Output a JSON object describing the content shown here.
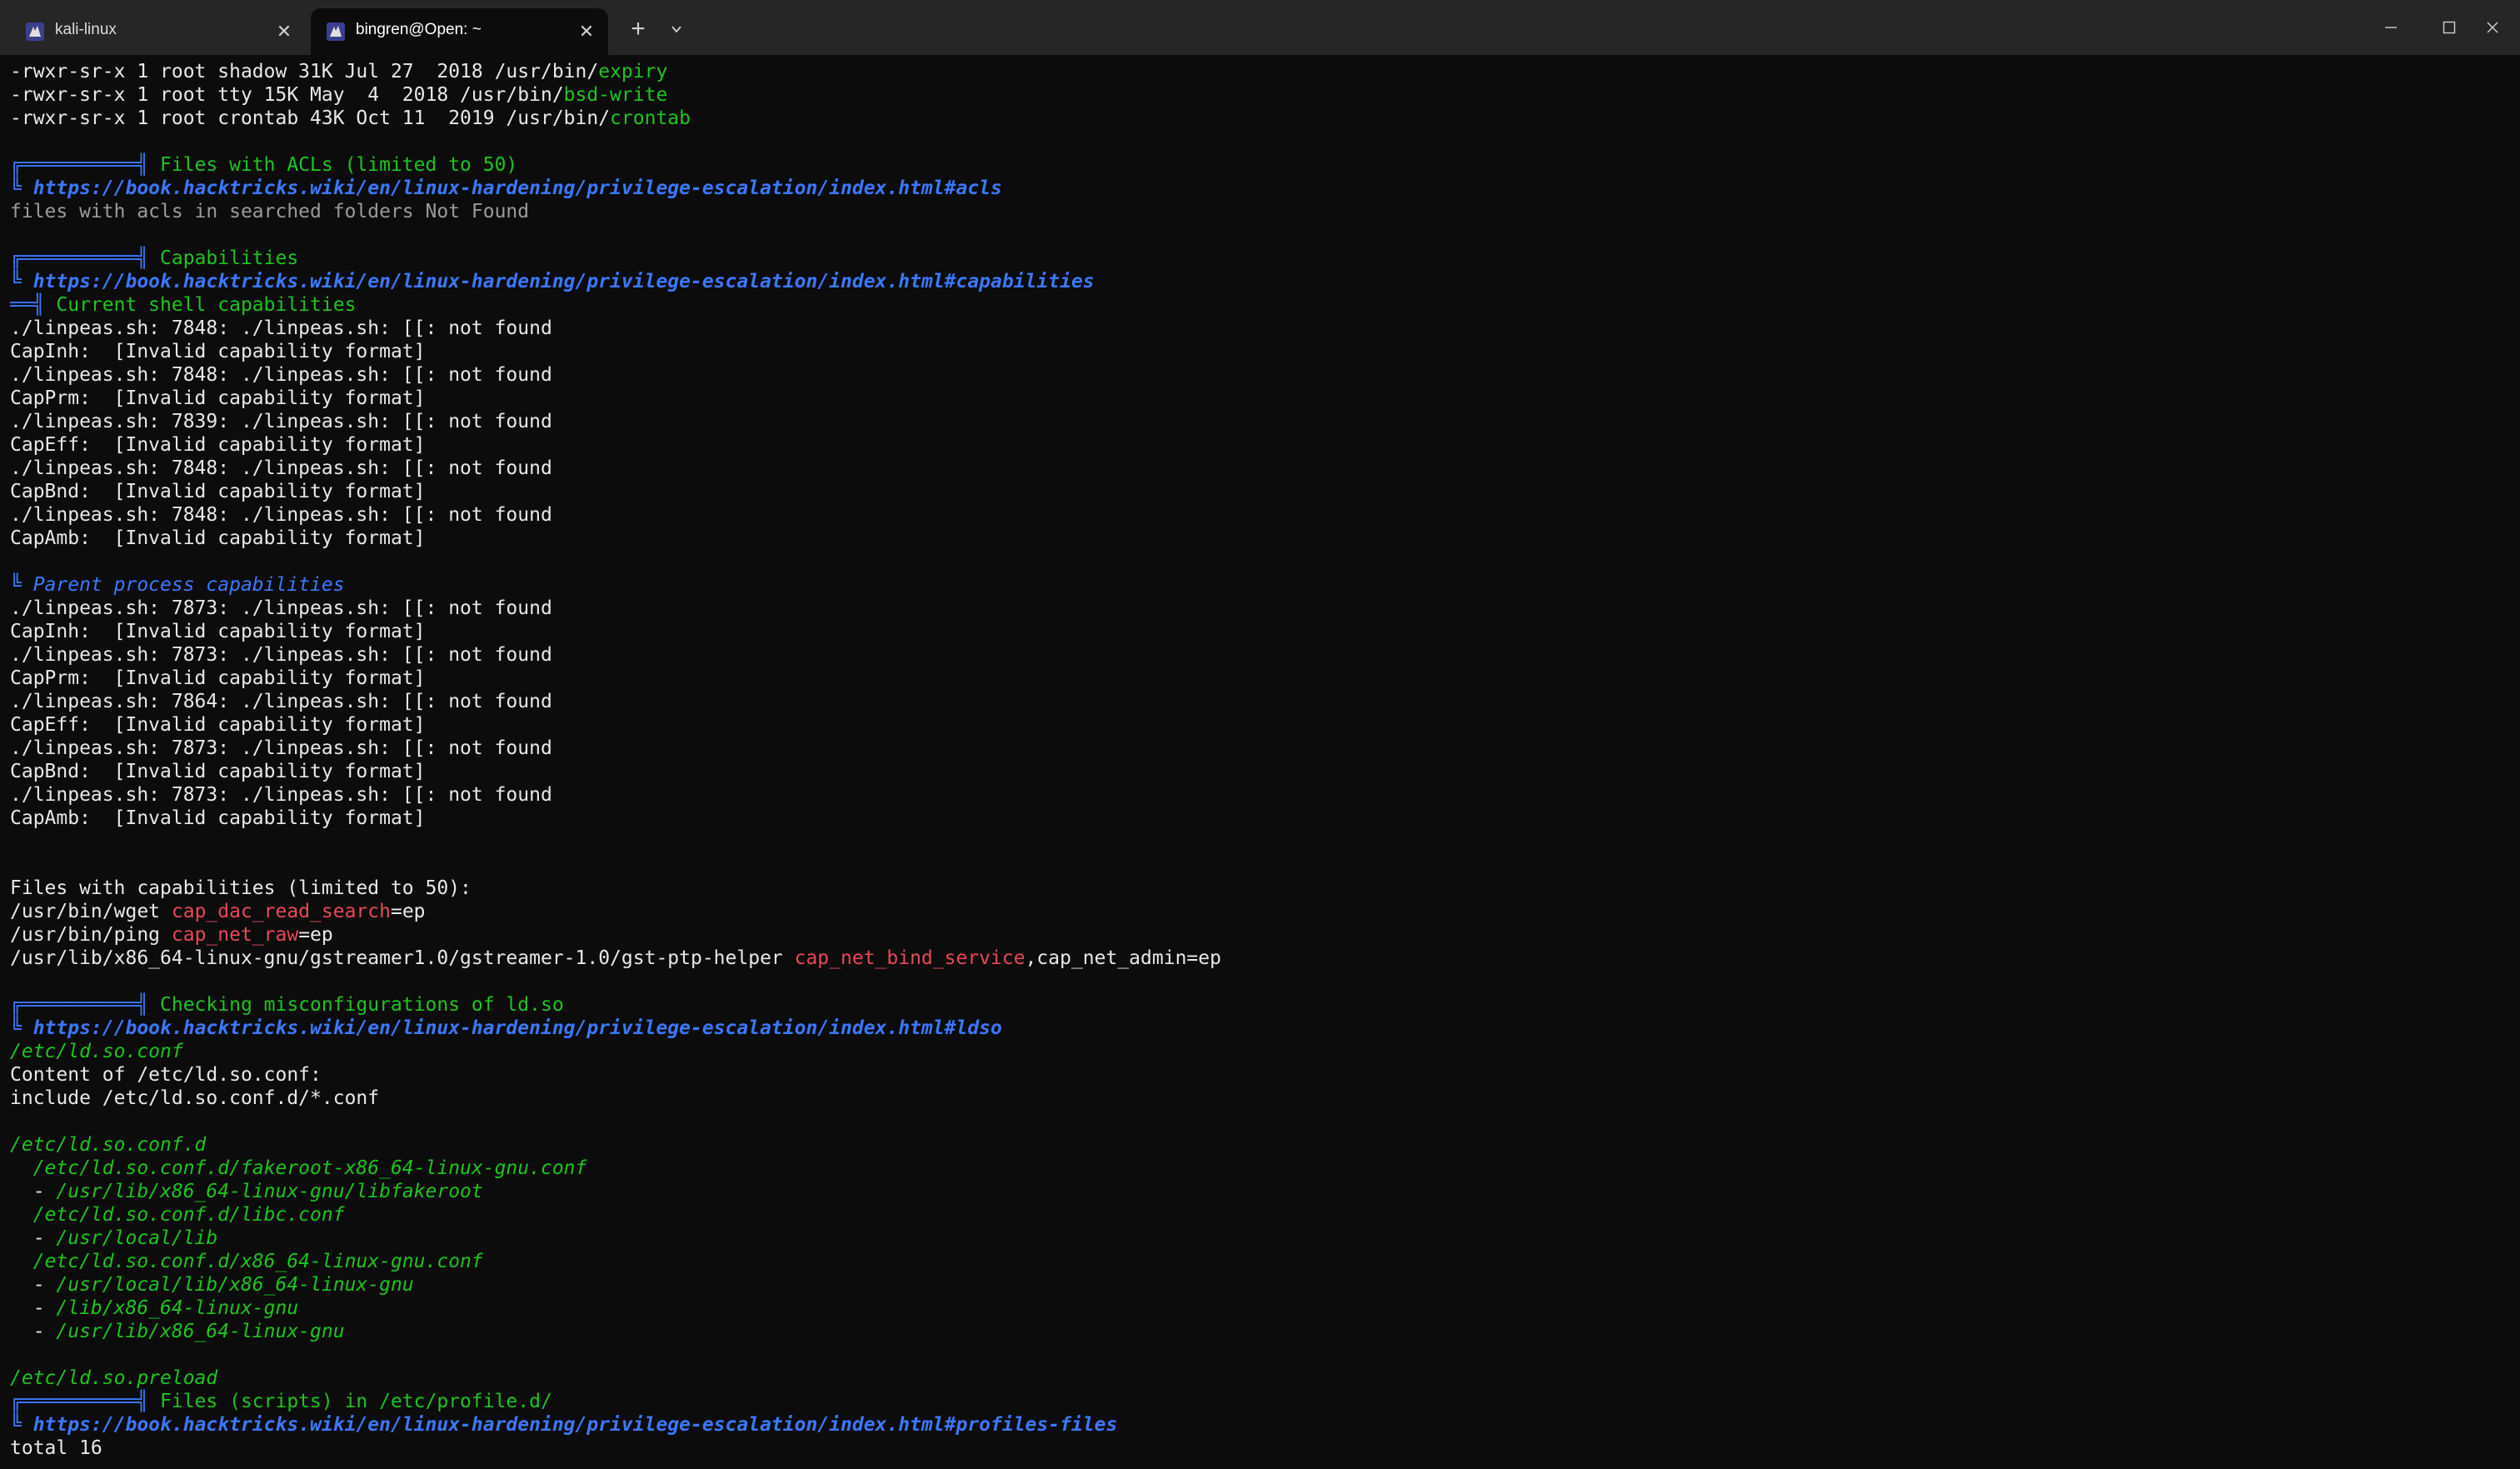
{
  "window": {
    "tabs": [
      {
        "title": "kali-linux",
        "active": false,
        "icon": "terminal-profile-icon"
      },
      {
        "title": "bingren@Open: ~",
        "active": true,
        "icon": "terminal-profile-icon"
      }
    ],
    "new_tab_label": "+",
    "close_glyph": "✕"
  },
  "colors": {
    "background": "#0c0c0c",
    "text": "#e8e8e8",
    "green": "#1ec41e",
    "blue": "#3b78ff",
    "red": "#e74856",
    "gray": "#9a9a9a"
  },
  "terminal": {
    "lines": [
      [
        {
          "t": "-rwxr-sr-x 1 root shadow 31K Jul 27  2018 /usr/bin/",
          "s": "white"
        },
        {
          "t": "expiry",
          "s": "green"
        }
      ],
      [
        {
          "t": "-rwxr-sr-x 1 root tty 15K May  4  2018 /usr/bin/",
          "s": "white"
        },
        {
          "t": "bsd-write",
          "s": "green"
        }
      ],
      [
        {
          "t": "-rwxr-sr-x 1 root crontab 43K Oct 11  2019 /usr/bin/",
          "s": "white"
        },
        {
          "t": "crontab",
          "s": "green"
        }
      ],
      [],
      [
        {
          "t": "╔══════════╣ ",
          "s": "blue"
        },
        {
          "t": "Files with ACLs (limited to 50)",
          "s": "green"
        }
      ],
      [
        {
          "t": "╚ ",
          "s": "blue"
        },
        {
          "t": "https://book.hacktricks.wiki/en/linux-hardening/privilege-escalation/index.html#acls",
          "s": "blue-bi"
        }
      ],
      [
        {
          "t": "files with acls in searched folders Not Found",
          "s": "gray"
        }
      ],
      [],
      [
        {
          "t": "╔══════════╣ ",
          "s": "blue"
        },
        {
          "t": "Capabilities",
          "s": "green"
        }
      ],
      [
        {
          "t": "╚ ",
          "s": "blue"
        },
        {
          "t": "https://book.hacktricks.wiki/en/linux-hardening/privilege-escalation/index.html#capabilities",
          "s": "blue-bi"
        }
      ],
      [
        {
          "t": "══╣ ",
          "s": "blue"
        },
        {
          "t": "Current shell capabilities",
          "s": "green"
        }
      ],
      [
        {
          "t": "./linpeas.sh: 7848: ./linpeas.sh: [[: not found",
          "s": "white"
        }
      ],
      [
        {
          "t": "CapInh:  [Invalid capability format]",
          "s": "white"
        }
      ],
      [
        {
          "t": "./linpeas.sh: 7848: ./linpeas.sh: [[: not found",
          "s": "white"
        }
      ],
      [
        {
          "t": "CapPrm:  [Invalid capability format]",
          "s": "white"
        }
      ],
      [
        {
          "t": "./linpeas.sh: 7839: ./linpeas.sh: [[: not found",
          "s": "white"
        }
      ],
      [
        {
          "t": "CapEff:  [Invalid capability format]",
          "s": "white"
        }
      ],
      [
        {
          "t": "./linpeas.sh: 7848: ./linpeas.sh: [[: not found",
          "s": "white"
        }
      ],
      [
        {
          "t": "CapBnd:  [Invalid capability format]",
          "s": "white"
        }
      ],
      [
        {
          "t": "./linpeas.sh: 7848: ./linpeas.sh: [[: not found",
          "s": "white"
        }
      ],
      [
        {
          "t": "CapAmb:  [Invalid capability format]",
          "s": "white"
        }
      ],
      [],
      [
        {
          "t": "╚ ",
          "s": "blue"
        },
        {
          "t": "Parent process capabilities",
          "s": "blue-i"
        }
      ],
      [
        {
          "t": "./linpeas.sh: 7873: ./linpeas.sh: [[: not found",
          "s": "white"
        }
      ],
      [
        {
          "t": "CapInh:  [Invalid capability format]",
          "s": "white"
        }
      ],
      [
        {
          "t": "./linpeas.sh: 7873: ./linpeas.sh: [[: not found",
          "s": "white"
        }
      ],
      [
        {
          "t": "CapPrm:  [Invalid capability format]",
          "s": "white"
        }
      ],
      [
        {
          "t": "./linpeas.sh: 7864: ./linpeas.sh: [[: not found",
          "s": "white"
        }
      ],
      [
        {
          "t": "CapEff:  [Invalid capability format]",
          "s": "white"
        }
      ],
      [
        {
          "t": "./linpeas.sh: 7873: ./linpeas.sh: [[: not found",
          "s": "white"
        }
      ],
      [
        {
          "t": "CapBnd:  [Invalid capability format]",
          "s": "white"
        }
      ],
      [
        {
          "t": "./linpeas.sh: 7873: ./linpeas.sh: [[: not found",
          "s": "white"
        }
      ],
      [
        {
          "t": "CapAmb:  [Invalid capability format]",
          "s": "white"
        }
      ],
      [],
      [],
      [
        {
          "t": "Files with capabilities (limited to 50):",
          "s": "white"
        }
      ],
      [
        {
          "t": "/usr/bin/wget ",
          "s": "white"
        },
        {
          "t": "cap_dac_read_search",
          "s": "red"
        },
        {
          "t": "=ep",
          "s": "white"
        }
      ],
      [
        {
          "t": "/usr/bin/ping ",
          "s": "white"
        },
        {
          "t": "cap_net_raw",
          "s": "red"
        },
        {
          "t": "=ep",
          "s": "white"
        }
      ],
      [
        {
          "t": "/usr/lib/x86_64-linux-gnu/gstreamer1.0/gstreamer-1.0/gst-ptp-helper ",
          "s": "white"
        },
        {
          "t": "cap_net_bind_service",
          "s": "red"
        },
        {
          "t": ",cap_net_admin=ep",
          "s": "white"
        }
      ],
      [],
      [
        {
          "t": "╔══════════╣ ",
          "s": "blue"
        },
        {
          "t": "Checking misconfigurations of ld.so",
          "s": "green"
        }
      ],
      [
        {
          "t": "╚ ",
          "s": "blue"
        },
        {
          "t": "https://book.hacktricks.wiki/en/linux-hardening/privilege-escalation/index.html#ldso",
          "s": "blue-bi"
        }
      ],
      [
        {
          "t": "/etc/ld.so.conf",
          "s": "green-i"
        }
      ],
      [
        {
          "t": "Content of /etc/ld.so.conf:",
          "s": "white"
        }
      ],
      [
        {
          "t": "include /etc/ld.so.conf.d/*.conf",
          "s": "white"
        }
      ],
      [],
      [
        {
          "t": "/etc/ld.so.conf.d",
          "s": "green-i"
        }
      ],
      [
        {
          "t": "  /etc/ld.so.conf.d/fakeroot-x86_64-linux-gnu.conf",
          "s": "green-i"
        }
      ],
      [
        {
          "t": "  - ",
          "s": "white"
        },
        {
          "t": "/usr/lib/x86_64-linux-gnu/libfakeroot",
          "s": "green-i"
        }
      ],
      [
        {
          "t": "  /etc/ld.so.conf.d/libc.conf",
          "s": "green-i"
        }
      ],
      [
        {
          "t": "  - ",
          "s": "white"
        },
        {
          "t": "/usr/local/lib",
          "s": "green-i"
        }
      ],
      [
        {
          "t": "  /etc/ld.so.conf.d/x86_64-linux-gnu.conf",
          "s": "green-i"
        }
      ],
      [
        {
          "t": "  - ",
          "s": "white"
        },
        {
          "t": "/usr/local/lib/x86_64-linux-gnu",
          "s": "green-i"
        }
      ],
      [
        {
          "t": "  - ",
          "s": "white"
        },
        {
          "t": "/lib/x86_64-linux-gnu",
          "s": "green-i"
        }
      ],
      [
        {
          "t": "  - ",
          "s": "white"
        },
        {
          "t": "/usr/lib/x86_64-linux-gnu",
          "s": "green-i"
        }
      ],
      [],
      [
        {
          "t": "/etc/ld.so.preload",
          "s": "green-i"
        }
      ],
      [
        {
          "t": "╔══════════╣ ",
          "s": "blue"
        },
        {
          "t": "Files (scripts) in /etc/profile.d/",
          "s": "green"
        }
      ],
      [
        {
          "t": "╚ ",
          "s": "blue"
        },
        {
          "t": "https://book.hacktricks.wiki/en/linux-hardening/privilege-escalation/index.html#profiles-files",
          "s": "blue-bi"
        }
      ],
      [
        {
          "t": "total 16",
          "s": "white"
        }
      ]
    ]
  }
}
